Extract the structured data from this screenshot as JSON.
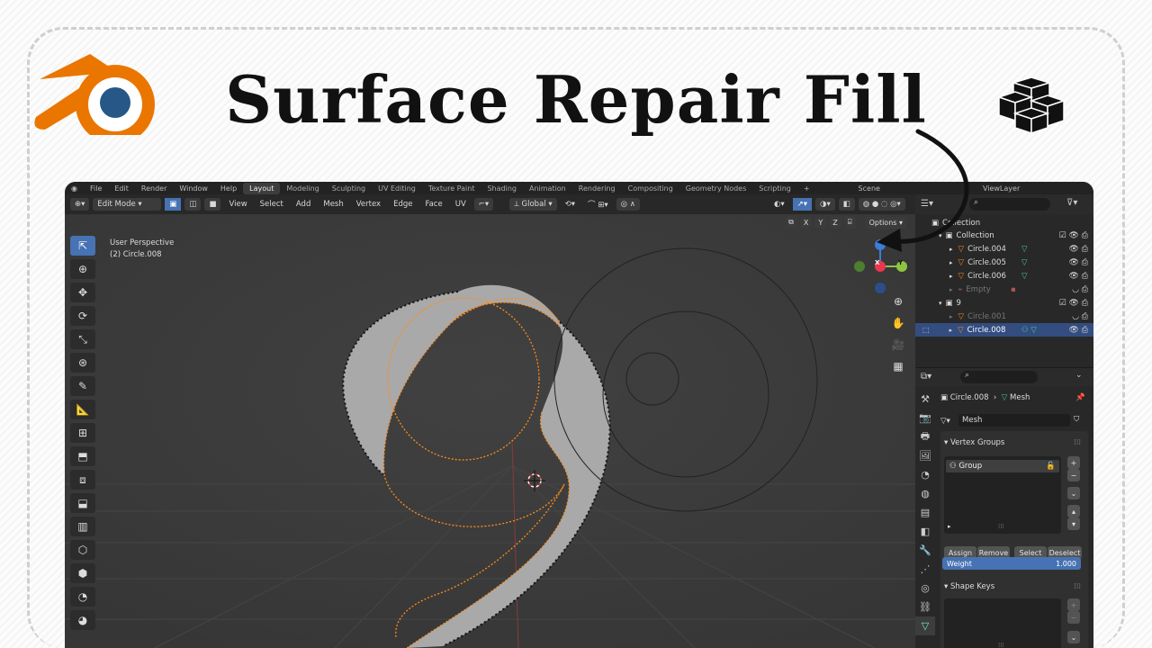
{
  "thumbnail": {
    "title": "Surface Repair Fill"
  },
  "menu": {
    "items": [
      "File",
      "Edit",
      "Render",
      "Window",
      "Help"
    ],
    "workspaces": [
      "Layout",
      "Modeling",
      "Sculpting",
      "UV Editing",
      "Texture Paint",
      "Shading",
      "Animation",
      "Rendering",
      "Compositing",
      "Geometry Nodes",
      "Scripting"
    ],
    "add_tab": "+",
    "scene": "Scene",
    "view_layer": "ViewLayer"
  },
  "header": {
    "mode": "Edit Mode",
    "menus": [
      "View",
      "Select",
      "Add",
      "Mesh",
      "Vertex",
      "Edge",
      "Face",
      "UV"
    ],
    "orientation": "Global",
    "options": "Options",
    "axes": [
      "X",
      "Y",
      "Z"
    ]
  },
  "viewport": {
    "view_name": "User Perspective",
    "object_info": "(2) Circle.008",
    "gizmo": {
      "x_color": "#e8384f",
      "y_color": "#8cc540",
      "z_color": "#3b7dd8",
      "x": "X",
      "y": "Y"
    }
  },
  "outliner": {
    "rows": [
      {
        "label": "Collection",
        "indent": 0,
        "type": "collection"
      },
      {
        "label": "Collection",
        "indent": 1,
        "type": "collection"
      },
      {
        "label": "Circle.004",
        "indent": 2,
        "type": "mesh"
      },
      {
        "label": "Circle.005",
        "indent": 2,
        "type": "mesh"
      },
      {
        "label": "Circle.006",
        "indent": 2,
        "type": "mesh"
      },
      {
        "label": "Empty",
        "indent": 2,
        "type": "empty"
      },
      {
        "label": "9",
        "indent": 1,
        "type": "collection"
      },
      {
        "label": "Circle.001",
        "indent": 2,
        "type": "mesh"
      },
      {
        "label": "Circle.008",
        "indent": 2,
        "type": "mesh"
      }
    ]
  },
  "properties": {
    "object": "Circle.008",
    "data_type": "Mesh",
    "mesh_name": "Mesh",
    "vertex_groups_title": "Vertex Groups",
    "group_name": "Group",
    "assign": "Assign",
    "remove": "Remove",
    "select": "Select",
    "deselect": "Deselect",
    "weight_label": "Weight",
    "weight_value": "1.000",
    "weight": 1.0,
    "shape_keys_title": "Shape Keys"
  },
  "colors": {
    "accent": "#4772b3",
    "orange": "#ff8c1a",
    "blender_orange": "#ea7600",
    "blender_blue": "#265787"
  }
}
